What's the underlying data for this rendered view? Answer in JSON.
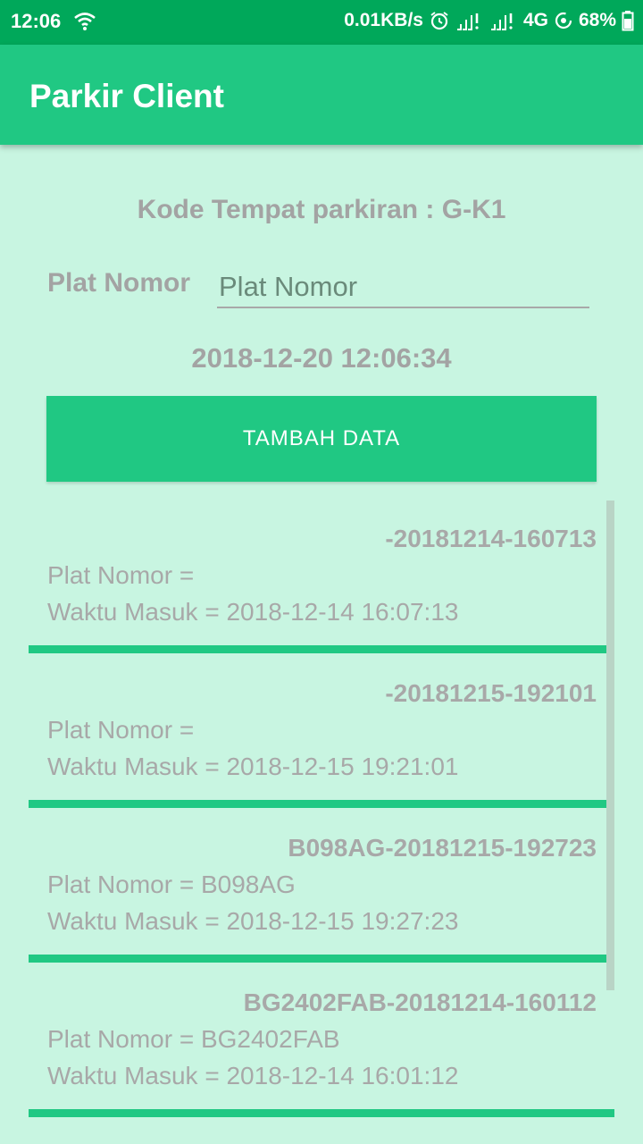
{
  "status_bar": {
    "time": "12:06",
    "speed": "0.01KB/s",
    "network": "4G",
    "battery": "68%",
    "icons": [
      "wifi-icon",
      "alarm-icon",
      "signal-icon",
      "signal-icon",
      "data-saver-icon",
      "battery-icon"
    ]
  },
  "app_bar": {
    "title": "Parkir Client"
  },
  "form": {
    "kode_text": "Kode Tempat parkiran : G-K1",
    "plat_label": "Plat Nomor",
    "plat_placeholder": "Plat Nomor",
    "plat_value": "",
    "datetime": "2018-12-20 12:06:34",
    "button_label": "TAMBAH DATA"
  },
  "list": {
    "items": [
      {
        "key": "-20181214-160713",
        "plat": "Plat Nomor = ",
        "waktu": "Waktu Masuk = 2018-12-14 16:07:13"
      },
      {
        "key": "-20181215-192101",
        "plat": "Plat Nomor = ",
        "waktu": "Waktu Masuk = 2018-12-15 19:21:01"
      },
      {
        "key": "B098AG-20181215-192723",
        "plat": "Plat Nomor = B098AG",
        "waktu": "Waktu Masuk = 2018-12-15 19:27:23"
      },
      {
        "key": "BG2402FAB-20181214-160112",
        "plat": "Plat Nomor = BG2402FAB",
        "waktu": "Waktu Masuk = 2018-12-14 16:01:12"
      }
    ]
  },
  "colors": {
    "status_bar": "#00a85a",
    "primary": "#20c883",
    "background": "#c8f5e1",
    "text_gray": "#a3a3a3"
  }
}
